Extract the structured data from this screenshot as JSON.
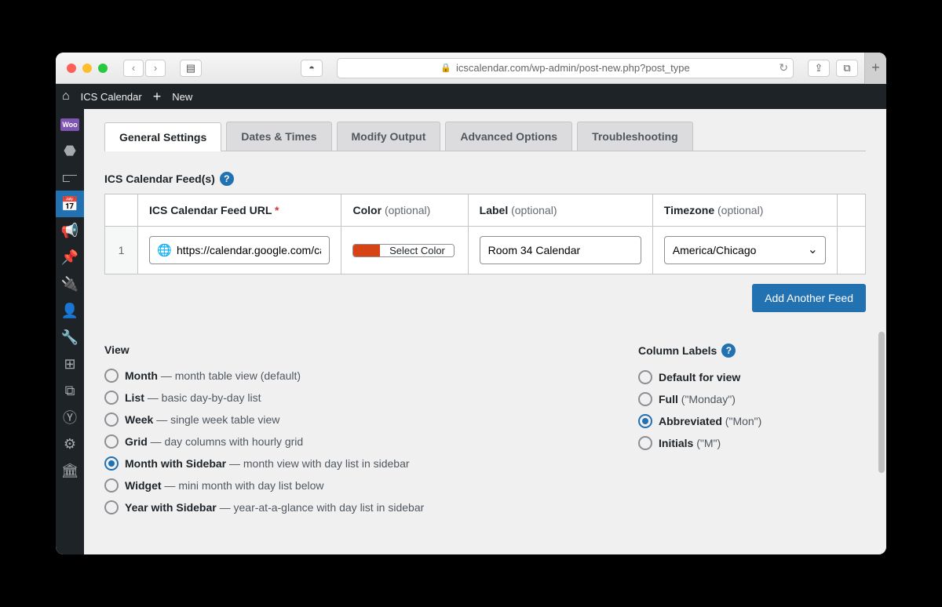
{
  "browser": {
    "url": "icscalendar.com/wp-admin/post-new.php?post_type"
  },
  "adminbar": {
    "site": "ICS Calendar",
    "new": "New"
  },
  "tabs": [
    "General Settings",
    "Dates & Times",
    "Modify Output",
    "Advanced Options",
    "Troubleshooting"
  ],
  "feeds": {
    "heading": "ICS Calendar Feed(s)",
    "columns": {
      "url": "ICS Calendar Feed URL",
      "color": "Color",
      "label": "Label",
      "tz": "Timezone",
      "opt": "(optional)"
    },
    "rownum": "1",
    "url_value": "https://calendar.google.com/calendar/",
    "color_label": "Select Color",
    "color_value": "#d84315",
    "label_value": "Room 34 Calendar",
    "tz_value": "America/Chicago",
    "add": "Add Another Feed"
  },
  "view": {
    "heading": "View",
    "options": [
      {
        "name": "Month",
        "desc": "month table view (default)",
        "checked": false
      },
      {
        "name": "List",
        "desc": "basic day-by-day list",
        "checked": false
      },
      {
        "name": "Week",
        "desc": "single week table view",
        "checked": false
      },
      {
        "name": "Grid",
        "desc": "day columns with hourly grid",
        "checked": false
      },
      {
        "name": "Month with Sidebar",
        "desc": "month view with day list in sidebar",
        "checked": true
      },
      {
        "name": "Widget",
        "desc": "mini month with day list below",
        "checked": false
      },
      {
        "name": "Year with Sidebar",
        "desc": "year-at-a-glance with day list in sidebar",
        "checked": false
      }
    ]
  },
  "column_labels": {
    "heading": "Column Labels",
    "options": [
      {
        "name": "Default for view",
        "example": "",
        "checked": false
      },
      {
        "name": "Full",
        "example": "(\"Monday\")",
        "checked": false
      },
      {
        "name": "Abbreviated",
        "example": "(\"Mon\")",
        "checked": true
      },
      {
        "name": "Initials",
        "example": "(\"M\")",
        "checked": false
      }
    ]
  }
}
